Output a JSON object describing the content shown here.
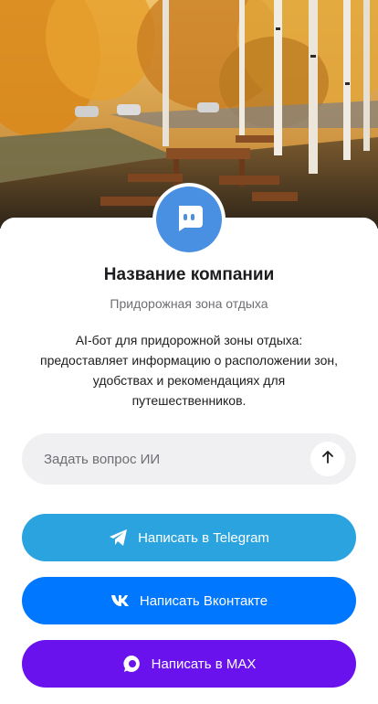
{
  "company": {
    "name": "Название компании",
    "subtitle": "Придорожная зона отдыха",
    "description": "AI-бот для придорожной зоны отдыха: предоставляет информацию о расположении зон, удобствах и рекомендациях для путешественников."
  },
  "ask": {
    "placeholder": "Задать вопрос ИИ",
    "send_icon": "arrow-up-icon"
  },
  "buttons": {
    "telegram": {
      "label": "Написать в Telegram",
      "icon": "telegram-icon",
      "color": "#2aa3df"
    },
    "vk": {
      "label": "Написать Вконтакте",
      "icon": "vk-icon",
      "color": "#0077ff"
    },
    "max": {
      "label": "Написать в MAX",
      "icon": "max-icon",
      "color": "#6a12ee"
    }
  },
  "colors": {
    "avatar": "#4a90e2"
  }
}
